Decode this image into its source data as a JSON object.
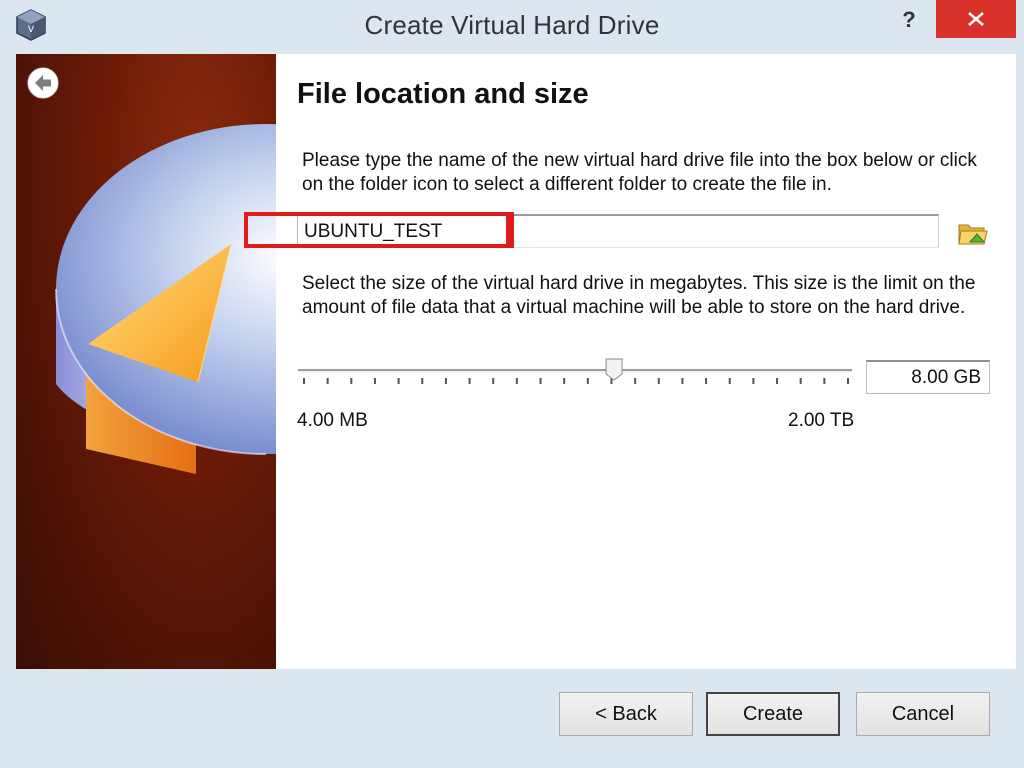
{
  "window": {
    "title": "Create Virtual Hard Drive",
    "help_label": "?",
    "icons": {
      "app": "virtualbox-icon",
      "close": "close-icon"
    }
  },
  "banner": {
    "back_icon": "back-arrow-icon",
    "illustration": "hard-drive-illustration"
  },
  "page": {
    "heading": "File location and size",
    "location_description": "Please type the name of the new virtual hard drive file into the box below or click on the folder icon to select a different folder to create the file in.",
    "file_name": "UBUNTU_TEST",
    "folder_icon": "folder-icon",
    "size_description": "Select the size of the virtual hard drive in megabytes. This size is the limit on the amount of file data that a virtual machine will be able to store on the hard drive.",
    "size_value": "8.00 GB",
    "slider": {
      "min_label": "4.00 MB",
      "max_label": "2.00 TB",
      "position_fraction": 0.57
    },
    "highlight_color": "#e01b1b"
  },
  "buttons": {
    "back": "< Back",
    "create": "Create",
    "cancel": "Cancel"
  },
  "colors": {
    "window_frame": "#dbe6f1",
    "close_button": "#d9322a",
    "banner": "#6e1c07"
  }
}
